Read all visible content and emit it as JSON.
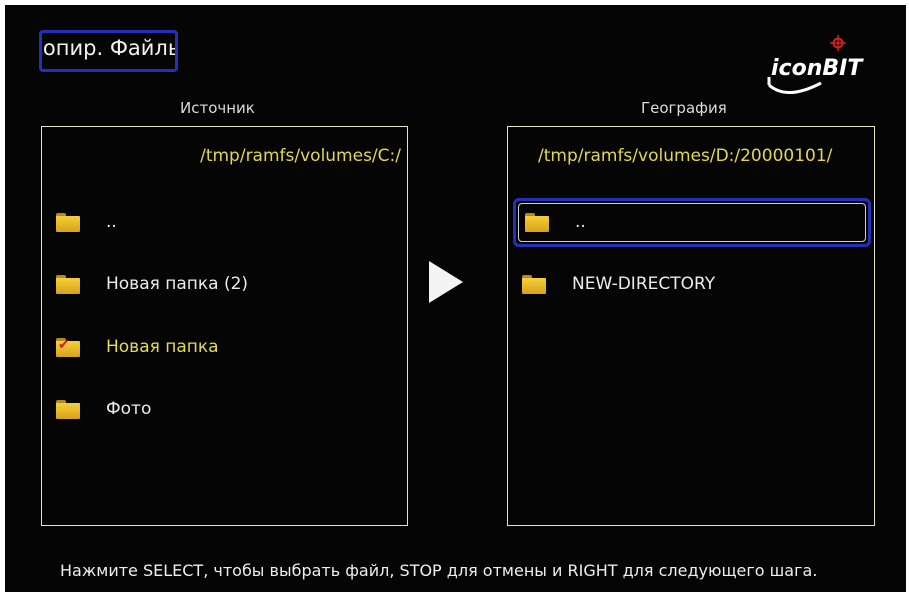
{
  "header": {
    "title": "Копир. Файлы",
    "logo_text": "iconBIT"
  },
  "source": {
    "label": "Источник",
    "path": "/tmp/ramfs/volumes/C:/",
    "items": [
      {
        "label": "..",
        "icon": "folder-icon",
        "selected": false
      },
      {
        "label": "Новая папка (2)",
        "icon": "folder-icon",
        "selected": false
      },
      {
        "label": "Новая папка",
        "icon": "folder-checked-icon",
        "selected": true
      },
      {
        "label": "Фото",
        "icon": "folder-icon",
        "selected": false
      }
    ]
  },
  "destination": {
    "label": "География",
    "path": "/tmp/ramfs/volumes/D:/20000101/",
    "items": [
      {
        "label": "..",
        "icon": "folder-icon",
        "focused": true
      },
      {
        "label": "NEW-DIRECTORY",
        "icon": "folder-icon",
        "focused": false
      }
    ]
  },
  "footer": {
    "hint": "Нажмите SELECT, чтобы выбрать файл, STOP для отмены и RIGHT для следующего шага."
  },
  "colors": {
    "background": "#050505",
    "focus_border": "#2330b8",
    "path_text": "#e2d84c",
    "pane_border": "#e7e4c2",
    "folder": "#f2c431"
  }
}
